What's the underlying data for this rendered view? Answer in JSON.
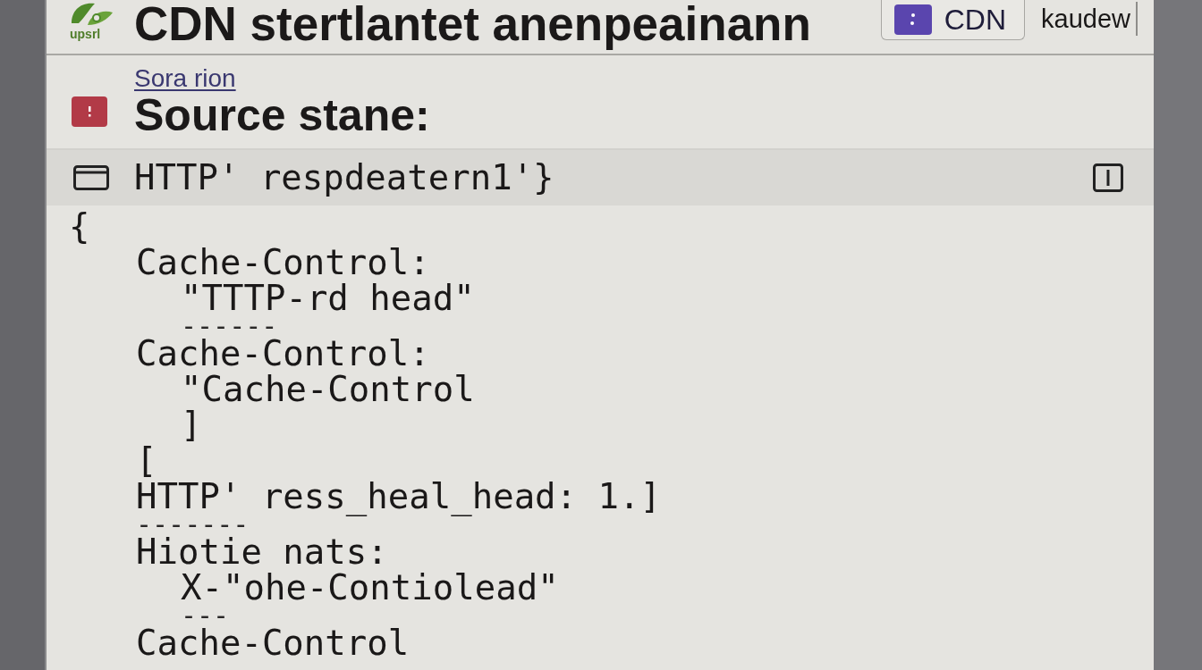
{
  "header": {
    "logo_text": "upsrl",
    "title": "CDN stertlantet anenpeainann",
    "buttons": [
      {
        "label": "CDN",
        "kind": "icon"
      },
      {
        "label": "kaudew",
        "kind": "plain"
      }
    ]
  },
  "source": {
    "link": "Sora rion",
    "title": "Source stane:"
  },
  "code_panel": {
    "title": "HTTP' respdeatern1'}",
    "lines": [
      {
        "kind": "brace",
        "text": "{"
      },
      {
        "kind": "key",
        "text": "Cache-Control:"
      },
      {
        "kind": "value",
        "text": "\"TTTP-rd head\"",
        "rule": "------"
      },
      {
        "kind": "key",
        "text": "Cache-Control:"
      },
      {
        "kind": "value",
        "text": "\"Cache-Control"
      },
      {
        "kind": "value",
        "text": "]"
      },
      {
        "kind": "key",
        "text": "["
      },
      {
        "kind": "key",
        "text": "HTTP' ress_heal_head: 1.]",
        "rule": "-------"
      },
      {
        "kind": "key",
        "text": "Hiotie nats:"
      },
      {
        "kind": "value",
        "text": "X-\"ohe-Contiolead\"",
        "rule": "---"
      },
      {
        "kind": "key",
        "text": "Cache-Control"
      }
    ]
  }
}
